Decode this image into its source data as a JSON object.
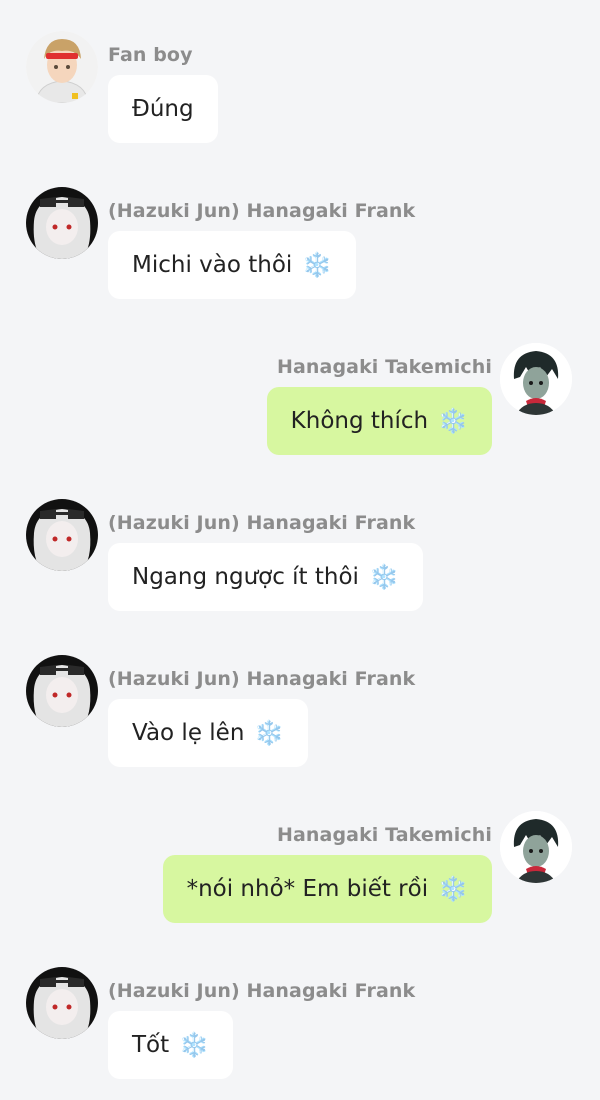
{
  "messages": [
    {
      "sender": "Fan boy",
      "text": "Đúng",
      "emoji": "",
      "side": "left",
      "avatar": "fanboy-avatar"
    },
    {
      "sender": "(Hazuki Jun) Hanagaki Frank",
      "text": "Michi vào thôi",
      "emoji": "❄️",
      "side": "left",
      "avatar": "frank-avatar"
    },
    {
      "sender": "Hanagaki Takemichi",
      "text": "Không thích",
      "emoji": "❄️",
      "side": "right",
      "avatar": "takemichi-avatar"
    },
    {
      "sender": "(Hazuki Jun) Hanagaki Frank",
      "text": "Ngang ngược ít thôi",
      "emoji": "❄️",
      "side": "left",
      "avatar": "frank-avatar"
    },
    {
      "sender": "(Hazuki Jun) Hanagaki Frank",
      "text": "Vào lẹ lên",
      "emoji": "❄️",
      "side": "left",
      "avatar": "frank-avatar"
    },
    {
      "sender": "Hanagaki Takemichi",
      "text": "*nói nhỏ* Em biết rồi",
      "emoji": "❄️",
      "side": "right",
      "avatar": "takemichi-avatar"
    },
    {
      "sender": "(Hazuki Jun) Hanagaki Frank",
      "text": "Tốt",
      "emoji": "❄️",
      "side": "left",
      "avatar": "frank-avatar"
    }
  ],
  "colors": {
    "background": "#f4f5f7",
    "incoming_bubble": "#ffffff",
    "outgoing_bubble": "#d7f7a0",
    "sender_name": "#8c8c8c"
  }
}
